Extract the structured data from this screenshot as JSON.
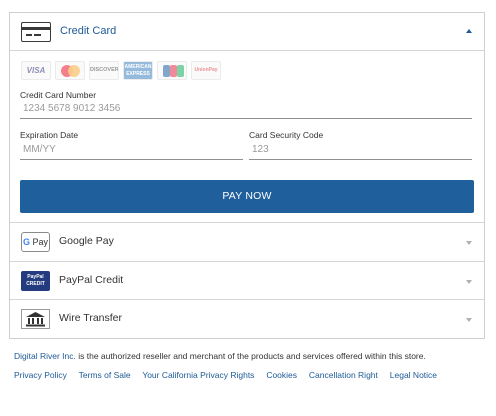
{
  "credit_card": {
    "title": "Credit Card",
    "logos": [
      "VISA",
      "DISCOVER",
      "AMERICAN EXPRESS",
      "UnionPay"
    ],
    "card_number": {
      "label": "Credit Card Number",
      "placeholder": "1234 5678 9012 3456"
    },
    "expiration": {
      "label": "Expiration Date",
      "placeholder": "MM/YY"
    },
    "security_code": {
      "label": "Card Security Code",
      "placeholder": "123"
    },
    "pay_button": "PAY NOW"
  },
  "payment_methods": [
    {
      "label": "Google Pay",
      "icon": "google-pay-icon",
      "icon_text": "Pay"
    },
    {
      "label": "PayPal Credit",
      "icon": "paypal-credit-icon",
      "icon_text": "PayPal CREDIT"
    },
    {
      "label": "Wire Transfer",
      "icon": "bank-icon"
    }
  ],
  "footer": {
    "brand": "Digital River Inc.",
    "text": " is the authorized reseller and merchant of the products and services offered within this store.",
    "links": [
      "Privacy Policy",
      "Terms of Sale",
      "Your California Privacy Rights",
      "Cookies",
      "Cancellation Right",
      "Legal Notice"
    ]
  },
  "colors": {
    "accent": "#1f5f9b",
    "link": "#1d5a96",
    "border": "#cfcfcf"
  }
}
